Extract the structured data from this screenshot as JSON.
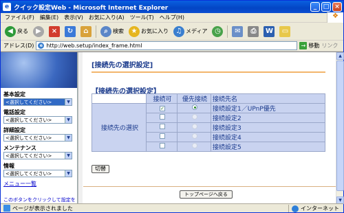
{
  "window": {
    "title": "クイック設定Web - Microsoft Internet Explorer",
    "app_icon": "ie-icon",
    "buttons": [
      "_",
      "□",
      "×"
    ]
  },
  "menubar": {
    "items": [
      "ファイル(F)",
      "編集(E)",
      "表示(V)",
      "お気に入り(A)",
      "ツール(T)",
      "ヘルプ(H)"
    ]
  },
  "toolbar": {
    "back_label": "戻る",
    "search_label": "検索",
    "favorites_label": "お気に入り",
    "media_label": "メディア"
  },
  "address": {
    "label": "アドレス(D)",
    "url": "http://web.setup/index_frame.html",
    "go_label": "移動",
    "links_label": "リンク"
  },
  "leftnav": {
    "sections": [
      {
        "label": "基本設定",
        "value": "<選択してください>"
      },
      {
        "label": "電話設定",
        "value": "<選択してください>"
      },
      {
        "label": "詳細設定",
        "value": "<選択してください>"
      },
      {
        "label": "メンテナンス",
        "value": "<選択してください>"
      },
      {
        "label": "情報",
        "value": "<選択してください>"
      }
    ],
    "menu_list_link": "メニュー一覧",
    "footer_text": "このボタンをクリックして設定を"
  },
  "main": {
    "page_title": "[接続先の選択設定]",
    "section_title": "【接続先の選択設定】",
    "table": {
      "headers": [
        "接続可",
        "優先接続",
        "接続先名"
      ],
      "row_header": "接続先の選択",
      "rows": [
        {
          "enabled": true,
          "priority": true,
          "name": "接続設定1／UPnP優先"
        },
        {
          "enabled": false,
          "priority": false,
          "name": "接続設定2"
        },
        {
          "enabled": false,
          "priority": false,
          "name": "接続設定3"
        },
        {
          "enabled": false,
          "priority": false,
          "name": "接続設定4"
        },
        {
          "enabled": false,
          "priority": false,
          "name": "接続設定5"
        }
      ]
    },
    "switch_button": "切替",
    "top_page_button": "トップページへ戻る"
  },
  "statusbar": {
    "text": "ページが表示されました",
    "zone": "インターネット"
  },
  "colors": {
    "title_bar": "#0a5fe0",
    "accent_text": "#1a3a8c",
    "table_cell": "#c9d3f0",
    "title_rule": "#f3b56b"
  }
}
